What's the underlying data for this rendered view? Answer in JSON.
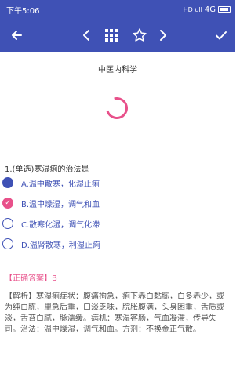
{
  "status_bar": {
    "time": "下午5:06",
    "signal_text": "HD ull",
    "network": "4G"
  },
  "toolbar": {
    "icons": [
      "back-arrow",
      "chevron-left",
      "grid",
      "star-outline",
      "chevron-right",
      "checkmark"
    ],
    "color": "#3f51b5"
  },
  "subject": "中医内科学",
  "question": {
    "text": "1.(单选)寒湿痢的治法是",
    "options": [
      {
        "label": "A.温中散寒，化湿止痢",
        "state": "selected"
      },
      {
        "label": "B.温中燥湿，调气和血",
        "state": "wrong-mark"
      },
      {
        "label": "C.散寒化湿，调气化滞",
        "state": "none"
      },
      {
        "label": "D.温肾散寒，利湿止痢",
        "state": "none"
      }
    ]
  },
  "answer": {
    "heading": "【正确答案】",
    "value": "B"
  },
  "analysis": "【解析】寒湿痢症状：腹痛拘急，痢下赤白黏胨，白多赤少，或为纯白胨，里急后重，口淡乏味，脘胀腹满，头身困重，舌质或淡，舌苔白腻，脉濡缓。病机：寒湿客肠，气血凝滞，传导失司。治法：温中燥湿，调气和血。方剂：不换金正气散。",
  "colors": {
    "primary": "#3f51b5",
    "accent": "#e8508a"
  }
}
